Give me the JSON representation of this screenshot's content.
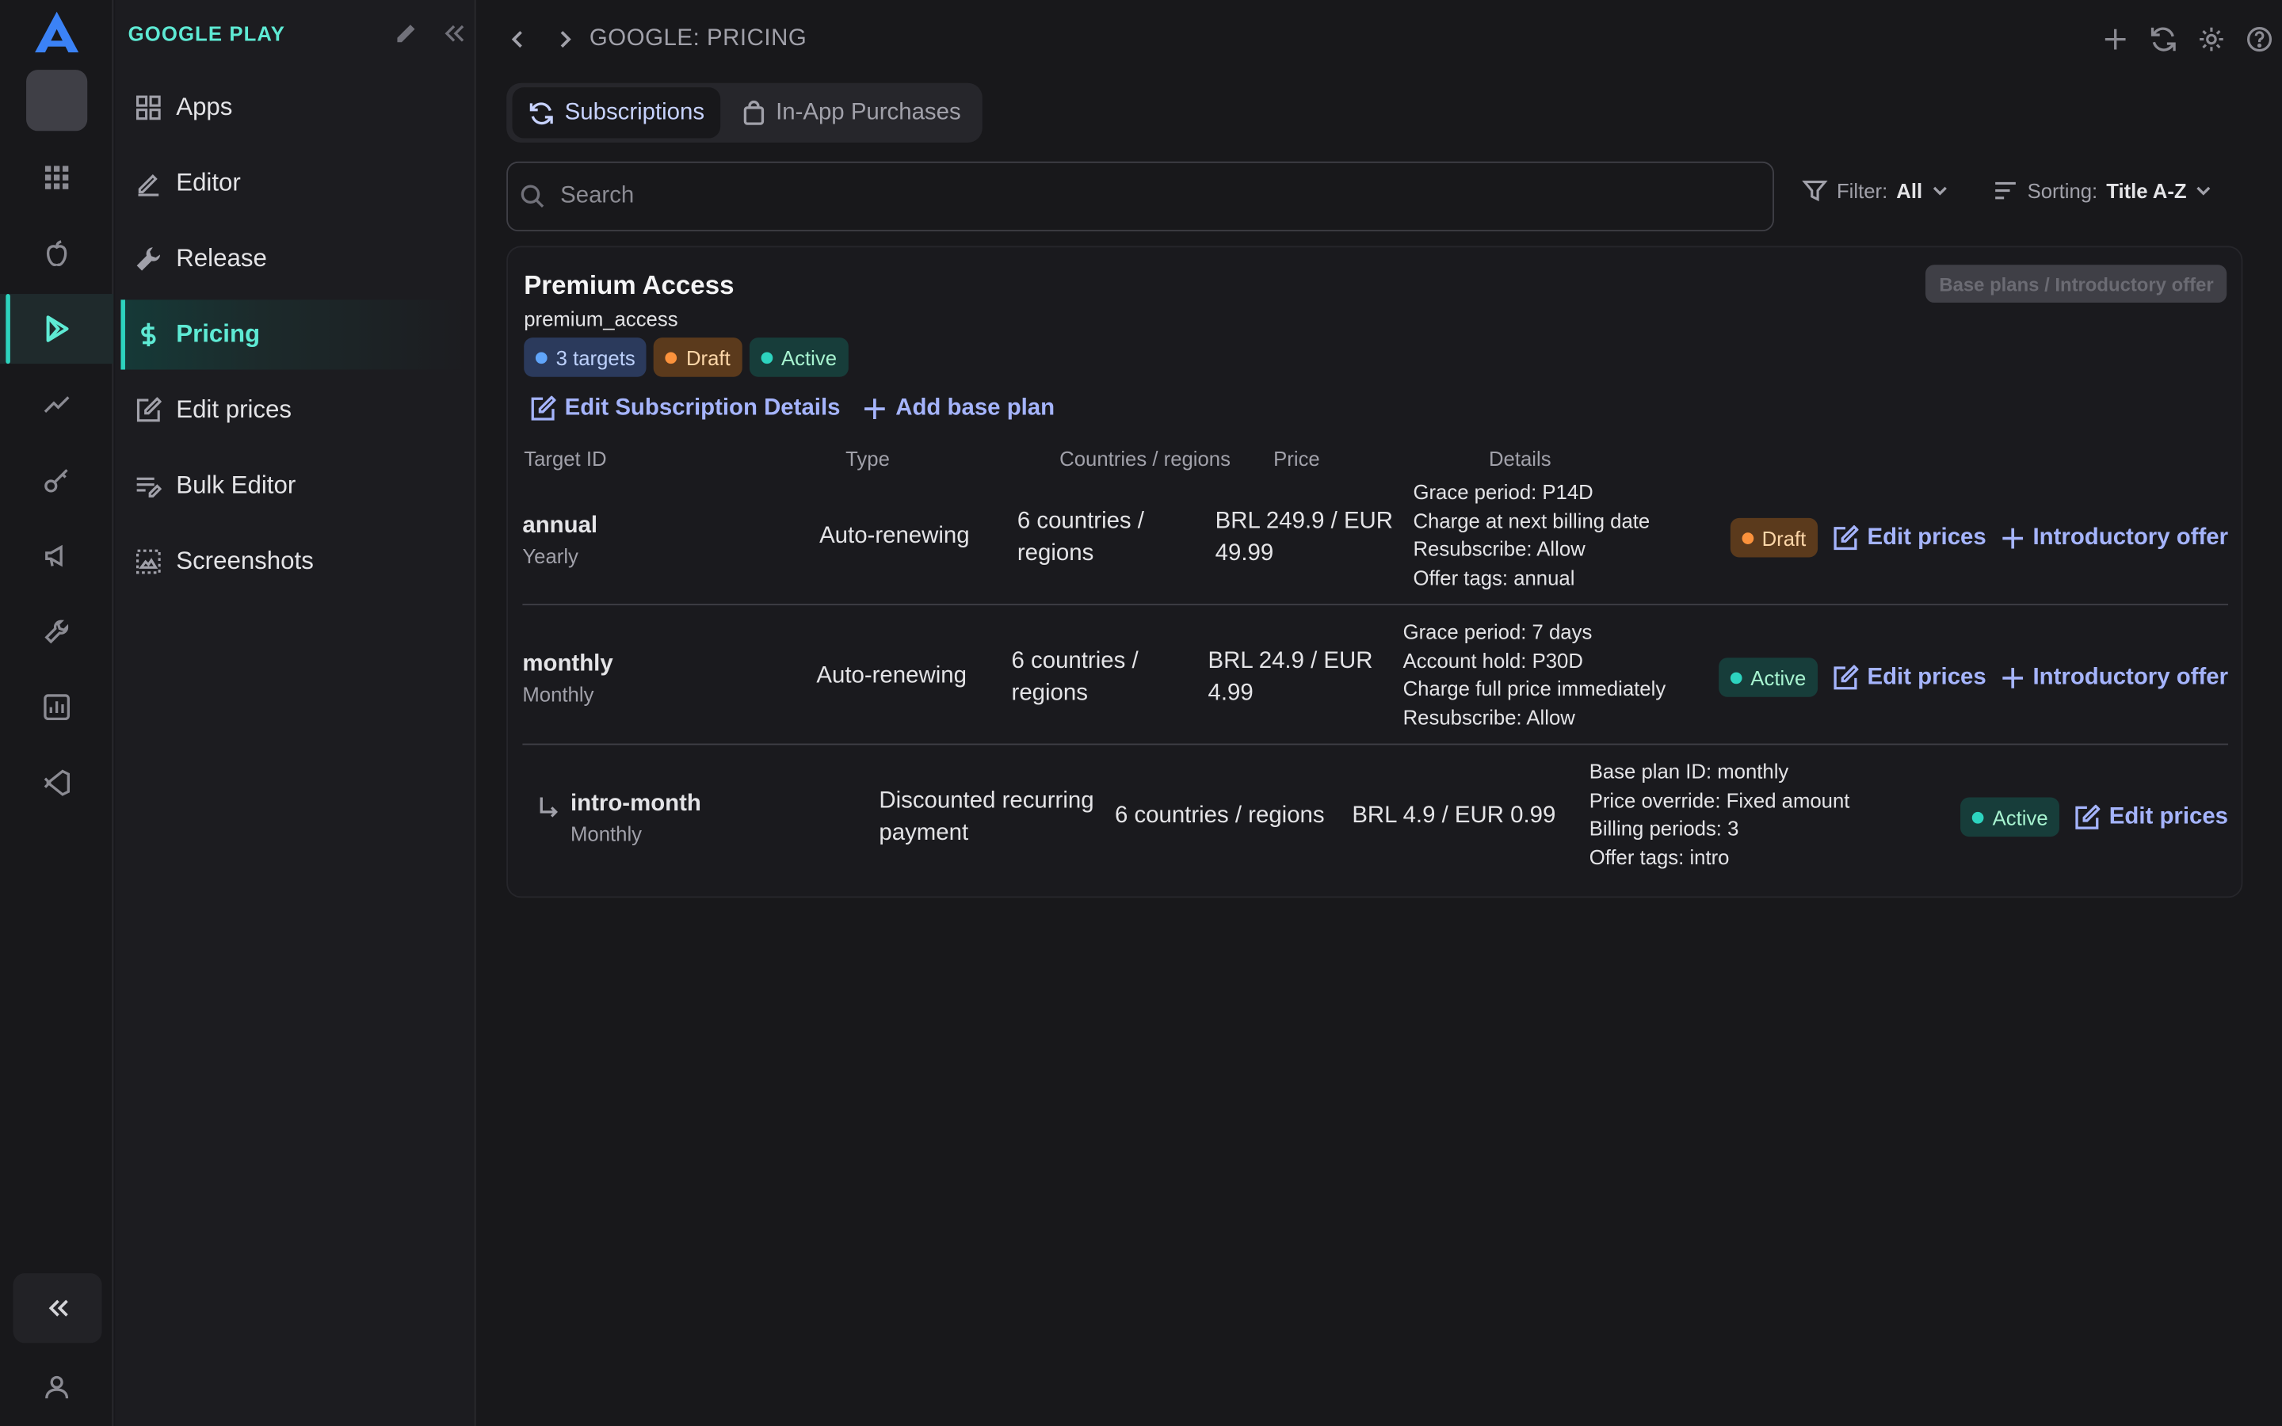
{
  "app": {
    "section_title": "GOOGLE PLAY",
    "breadcrumb": "GOOGLE: PRICING"
  },
  "sidebar": {
    "items": [
      {
        "label": "Apps",
        "icon": "grid-icon"
      },
      {
        "label": "Editor",
        "icon": "pencil-icon"
      },
      {
        "label": "Release",
        "icon": "wrench-icon"
      },
      {
        "label": "Pricing",
        "icon": "dollar-icon",
        "active": true
      },
      {
        "label": "Edit prices",
        "icon": "edit-square-icon"
      },
      {
        "label": "Bulk Editor",
        "icon": "list-edit-icon"
      },
      {
        "label": "Screenshots",
        "icon": "screenshot-icon"
      }
    ]
  },
  "tabs": [
    {
      "label": "Subscriptions",
      "active": true
    },
    {
      "label": "In-App Purchases",
      "active": false
    }
  ],
  "search": {
    "placeholder": "Search"
  },
  "filter": {
    "label": "Filter:",
    "value": "All"
  },
  "sorting": {
    "label": "Sorting:",
    "value": "Title A-Z"
  },
  "subscription": {
    "title": "Premium Access",
    "product_id": "premium_access",
    "badges": {
      "targets": "3 targets",
      "draft": "Draft",
      "active": "Active"
    },
    "base_plans_button": "Base plans / Introductory offer",
    "edit_details": "Edit Subscription Details",
    "add_base_plan": "Add base plan"
  },
  "table": {
    "headers": {
      "target_id": "Target ID",
      "type": "Type",
      "countries": "Countries / regions",
      "price": "Price",
      "details": "Details"
    },
    "rows": [
      {
        "id": "annual",
        "period": "Yearly",
        "type": "Auto-renewing",
        "countries": "6 countries / regions",
        "price": "BRL 249.9 / EUR 49.99",
        "details": [
          "Grace period: P14D",
          "Charge at next billing date",
          "Resubscribe: Allow",
          "Offer tags: annual"
        ],
        "status": "Draft",
        "edit": "Edit prices",
        "intro": "Introductory offer"
      },
      {
        "id": "monthly",
        "period": "Monthly",
        "type": "Auto-renewing",
        "countries": "6 countries / regions",
        "price": "BRL 24.9 / EUR 4.99",
        "details": [
          "Grace period: 7 days",
          "Account hold: P30D",
          "Charge full price immediately",
          "Resubscribe: Allow"
        ],
        "status": "Active",
        "edit": "Edit prices",
        "intro": "Introductory offer"
      },
      {
        "id": "intro-month",
        "period": "Monthly",
        "type": "Discounted recurring payment",
        "countries": "6 countries / regions",
        "price": "BRL 4.9 / EUR 0.99",
        "details": [
          "Base plan ID: monthly",
          "Price override: Fixed amount",
          "Billing periods: 3",
          "Offer tags: intro"
        ],
        "status": "Active",
        "edit": "Edit prices"
      }
    ]
  },
  "colors": {
    "accent": "#2dd4bf",
    "link": "#a5b4fc",
    "background": "#18181b"
  }
}
